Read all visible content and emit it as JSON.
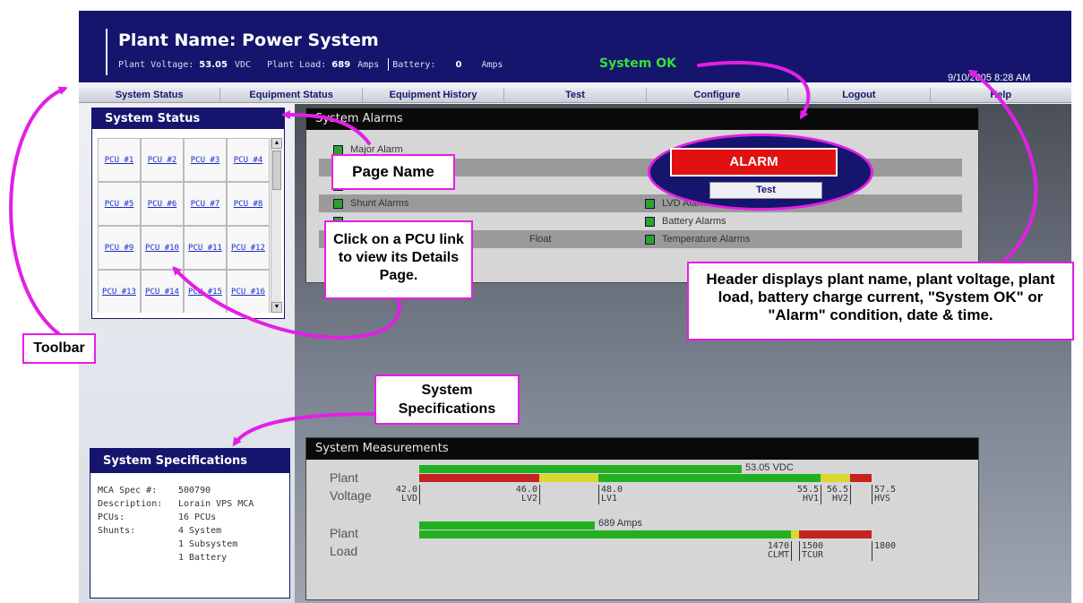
{
  "header": {
    "plant_name": "Plant Name: Power System",
    "voltage_label": "Plant Voltage:",
    "voltage_value": "53.05",
    "voltage_unit": "VDC",
    "load_label": "Plant Load:",
    "load_value": "689",
    "load_unit": "Amps",
    "battery_label": "Battery:",
    "battery_value": "0",
    "battery_unit": "Amps",
    "status": "System OK",
    "datetime": "9/10/2005 8:28 AM"
  },
  "toolbar": [
    "System Status",
    "Equipment Status",
    "Equipment History",
    "Test",
    "Configure",
    "Logout",
    "Help"
  ],
  "system_status": {
    "title": "System Status",
    "pcus": [
      "PCU #1",
      "PCU #2",
      "PCU #3",
      "PCU #4",
      "PCU #5",
      "PCU #6",
      "PCU #7",
      "PCU #8",
      "PCU #9",
      "PCU #10",
      "PCU #11",
      "PCU #12",
      "PCU #13",
      "PCU #14",
      "PCU #15",
      "PCU #16"
    ]
  },
  "system_specs": {
    "title": "System Specifications",
    "rows": [
      {
        "key": "MCA Spec #:",
        "value": "500790"
      },
      {
        "key": "Description:",
        "value": "Lorain VPS MCA"
      },
      {
        "key": "PCUs:",
        "value": "16 PCUs"
      },
      {
        "key": "Shunts:",
        "value": "4 System"
      },
      {
        "key": "",
        "value": "1 Subsystem"
      },
      {
        "key": "",
        "value": "1 Battery"
      }
    ]
  },
  "alarms": {
    "title": "System Alarms",
    "major": "Major Alarm",
    "shunt": "Shunt Alarms",
    "float": "Float",
    "lvd": "LVD Alarms",
    "battery": "Battery Alarms",
    "temperature": "Temperature Alarms",
    "alarm_banner": "ALARM",
    "test_button": "Test",
    "status_color": "#2aa32a"
  },
  "measurements": {
    "title": "System Measurements",
    "voltage": {
      "label_line1": "Plant",
      "label_line2": "Voltage",
      "value_text": "53.05 VDC",
      "ticks": [
        {
          "value": "42.0",
          "name": "LVD"
        },
        {
          "value": "46.0",
          "name": "LV2"
        },
        {
          "value": "48.0",
          "name": "LV1"
        },
        {
          "value": "55.5",
          "name": "HV1"
        },
        {
          "value": "56.5",
          "name": "HV2"
        },
        {
          "value": "57.5",
          "name": "HVS"
        }
      ]
    },
    "load": {
      "label_line1": "Plant",
      "label_line2": "Load",
      "value_text": "689 Amps",
      "ticks": [
        {
          "value": "1470",
          "name": "CLMT"
        },
        {
          "value": "1500",
          "name": "TCUR"
        },
        {
          "value": "1800",
          "name": ""
        }
      ]
    }
  },
  "callouts": {
    "page_name": "Page Name",
    "pcu_link": "Click on a PCU link to view its Details Page.",
    "toolbar": "Toolbar",
    "specs": "System Specifications",
    "header_desc": "Header displays plant name, plant voltage, plant load, battery charge current, \"System OK\" or \"Alarm\" condition, date & time."
  },
  "colors": {
    "header_bg": "#15156e",
    "ok_green": "#35e035",
    "alarm_red": "#e21111",
    "callout_magenta": "#e21fe6"
  }
}
